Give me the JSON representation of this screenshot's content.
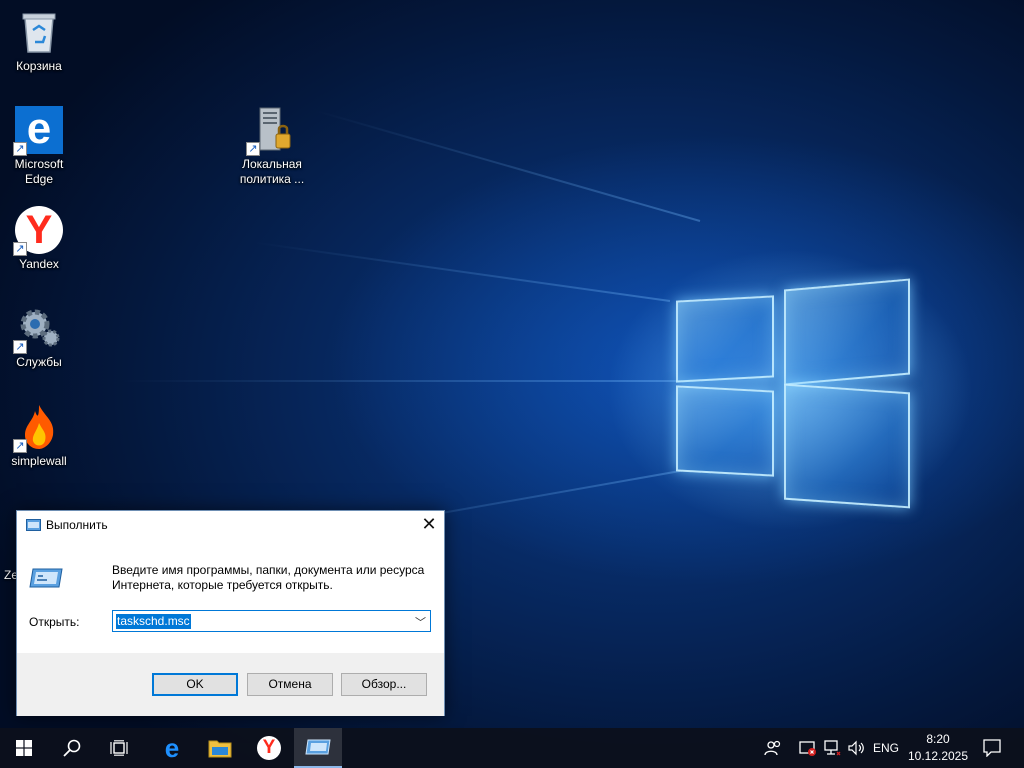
{
  "desktop": {
    "icons": [
      {
        "label": "Корзина",
        "icon": "recycle-bin-icon"
      },
      {
        "label": "Microsoft\nEdge",
        "icon": "edge-icon"
      },
      {
        "label": "Yandex",
        "icon": "yandex-icon"
      },
      {
        "label": "Службы",
        "icon": "services-gear-icon"
      },
      {
        "label": "simplewall",
        "icon": "simplewall-flame-icon"
      },
      {
        "label": "Локальная\nполитика ...",
        "icon": "local-policy-icon"
      }
    ],
    "partial_label": "Ze"
  },
  "run_dialog": {
    "title": "Выполнить",
    "description": "Введите имя программы, папки, документа или ресурса Интернета, которые требуется открыть.",
    "open_label": "Открыть:",
    "input_value": "taskschd.msc",
    "ok_label": "OK",
    "cancel_label": "Отмена",
    "browse_label": "Обзор..."
  },
  "taskbar": {
    "language": "ENG",
    "time": "8:20",
    "date": "10.12.2025",
    "pinned": [
      "start-icon",
      "search-icon",
      "task-view-icon",
      "edge-icon",
      "file-explorer-icon",
      "yandex-icon",
      "run-icon"
    ]
  },
  "colors": {
    "accent": "#0078d7",
    "taskbar": "#0c101c",
    "desktop_bg": "#072a64"
  }
}
